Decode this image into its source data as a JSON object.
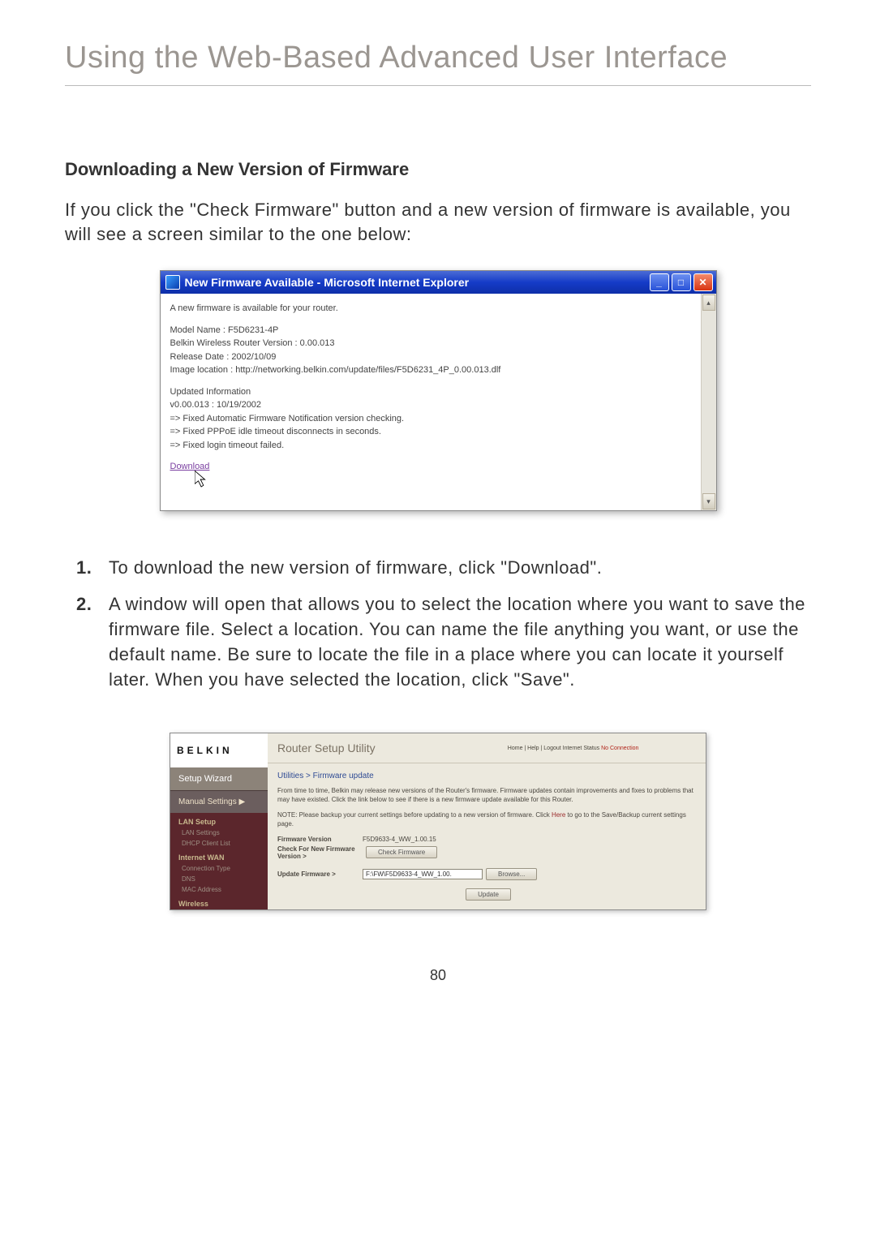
{
  "page": {
    "title": "Using the Web-Based Advanced User Interface",
    "number": "80"
  },
  "section": {
    "heading": "Downloading a New Version of Firmware",
    "intro": "If you click the \"Check Firmware\" button and a new version of firmware is available, you will see a screen similar to the one below:"
  },
  "ie": {
    "title": "New Firmware Available - Microsoft Internet Explorer",
    "line1": "A new firmware is available for your router.",
    "model": "Model Name : F5D6231-4P",
    "version": "Belkin Wireless Router Version : 0.00.013",
    "release": "Release Date : 2002/10/09",
    "image": "Image location : http://networking.belkin.com/update/files/F5D6231_4P_0.00.013.dlf",
    "upd_title": "Updated Information",
    "upd1": "v0.00.013 : 10/19/2002",
    "upd2": "=> Fixed Automatic Firmware Notification version checking.",
    "upd3": "=> Fixed PPPoE idle timeout disconnects in seconds.",
    "upd4": "=> Fixed login timeout failed.",
    "download": "Download"
  },
  "steps": {
    "s1": "To download the new version of firmware, click \"Download\".",
    "s2": "A window will open that allows you to select the location where you want to save the firmware file. Select a location. You can name the file anything you want, or use the default name. Be sure to locate the file in a place where you can locate it yourself later. When you have selected the location, click \"Save\"."
  },
  "router": {
    "logo": "BELKIN",
    "header_title": "Router Setup Utility",
    "header_links": "Home | Help | Logout   Internet Status ",
    "header_noconn": "No Connection",
    "wizard": "Setup Wizard",
    "manual": "Manual Settings ▶",
    "side": {
      "cat1": "LAN Setup",
      "s1a": "LAN Settings",
      "s1b": "DHCP Client List",
      "cat2": "Internet WAN",
      "s2a": "Connection Type",
      "s2b": "DNS",
      "s2c": "MAC Address",
      "cat3": "Wireless"
    },
    "crumb": "Utilities > Firmware update",
    "para1a": "From time to time, Belkin may release new versions of the Router's firmware. Firmware updates contain improvements and fixes to problems that may have existed. Click the link below to see if there is a new firmware update available for this Router.",
    "para2a": "NOTE: Please backup your current settings before updating to a new version of firmware. Click ",
    "para2link": "Here",
    "para2b": " to go to the Save/Backup current settings page.",
    "fw_label": "Firmware Version",
    "fw_val": "F5D9633-4_WW_1.00.15",
    "chk_label": "Check For New Firmware Version >",
    "chk_btn": "Check Firmware",
    "up_label": "Update Firmware >",
    "up_val": "F:\\FW\\F5D9633-4_WW_1.00.",
    "browse_btn": "Browse...",
    "update_btn": "Update"
  }
}
